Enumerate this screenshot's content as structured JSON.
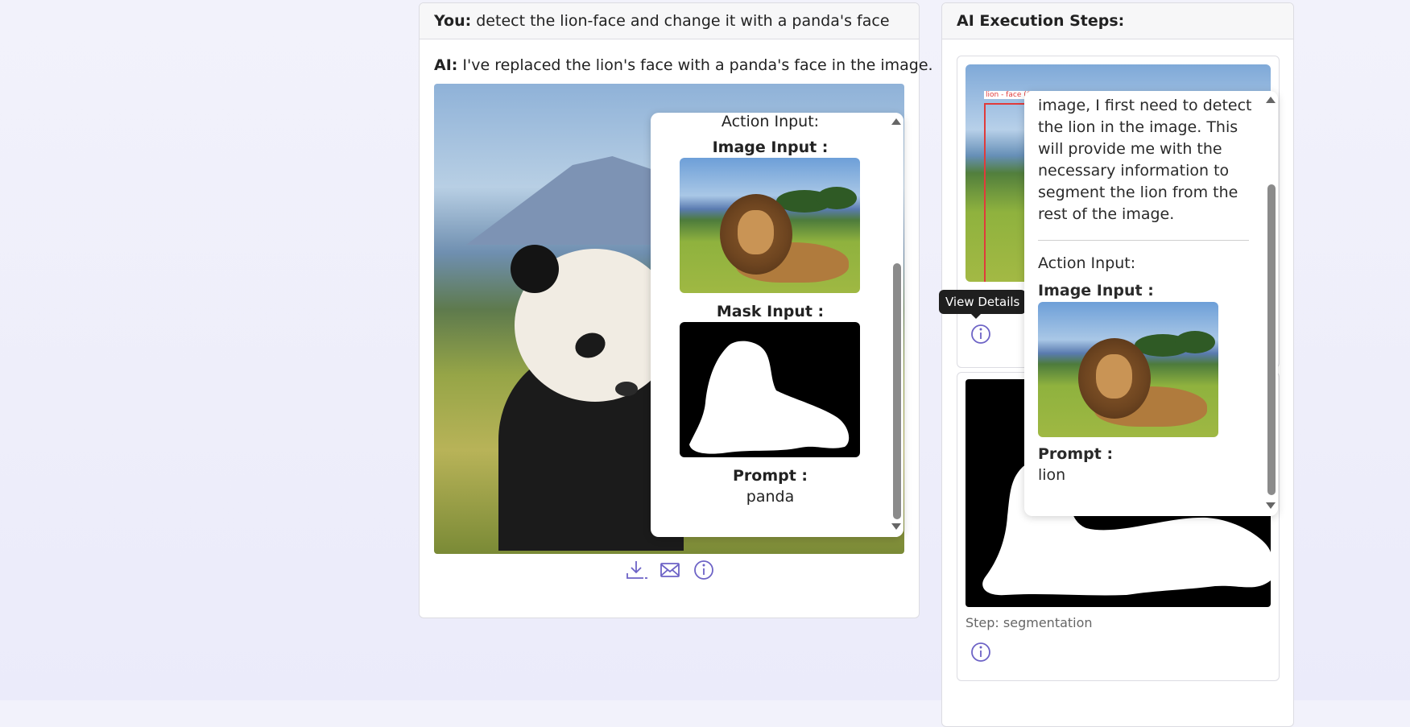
{
  "chat": {
    "user_label": "You:",
    "user_message": "detect the lion-face and change it with a panda's face",
    "ai_label": "AI:",
    "ai_message": "I've replaced the lion's face with a panda's face in the image.",
    "popover": {
      "action_input_label": "Action Input:",
      "image_input_label": "Image Input :",
      "mask_input_label": "Mask Input :",
      "prompt_label": "Prompt :",
      "prompt_value": "panda"
    },
    "actions": {
      "download": "download-icon",
      "email": "mail-icon",
      "info": "info-icon"
    }
  },
  "steps": {
    "title": "AI Execution Steps:",
    "detection_tag": "lion - face (0",
    "step2_label": "Step: segmentation",
    "tooltip": "View Details",
    "popover": {
      "text": "image, I first need to detect the lion in the image. This will provide me with the necessary information to segment the lion from the rest of the image.",
      "action_input_label": "Action Input:",
      "image_input_label": "Image Input :",
      "prompt_label": "Prompt :",
      "prompt_value": "lion"
    }
  },
  "colors": {
    "accent": "#6d63c6",
    "detection_box": "#e03b3b",
    "tooltip_bg": "#1f1f1f"
  }
}
